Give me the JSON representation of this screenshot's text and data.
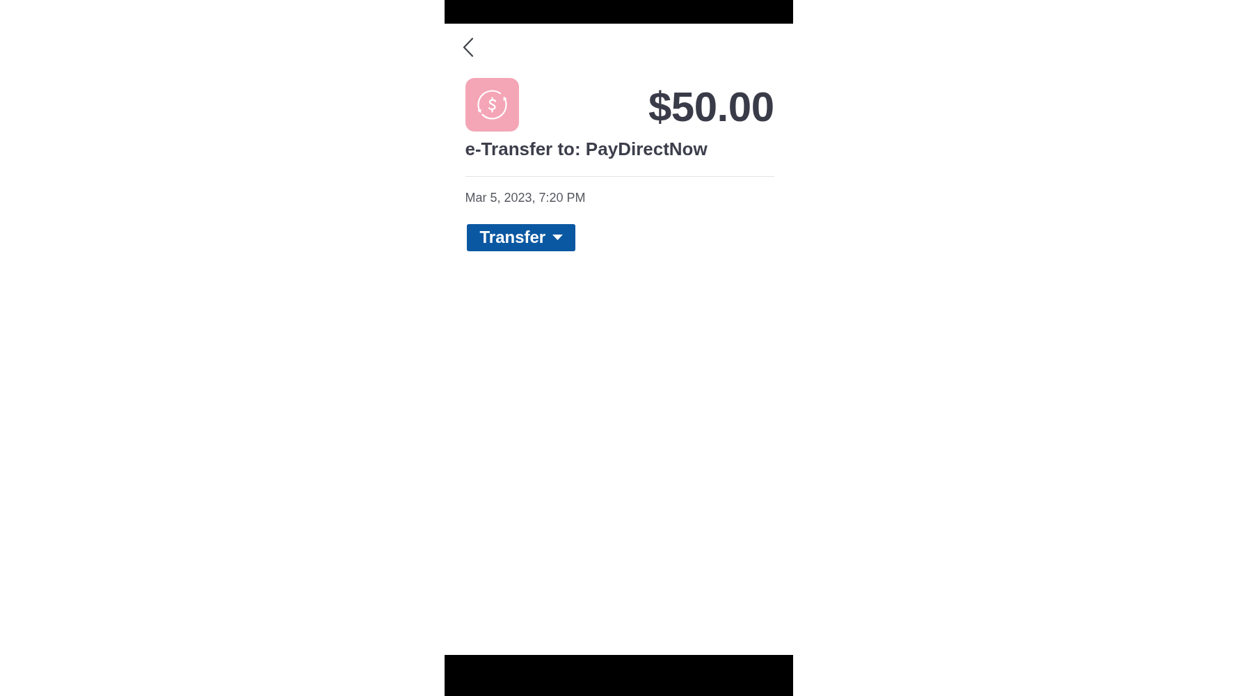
{
  "transaction": {
    "amount": "$50.00",
    "description": "e-Transfer to: PayDirectNow",
    "date": "Mar 5, 2023, 7:20 PM"
  },
  "category_dropdown": {
    "label": "Transfer"
  }
}
